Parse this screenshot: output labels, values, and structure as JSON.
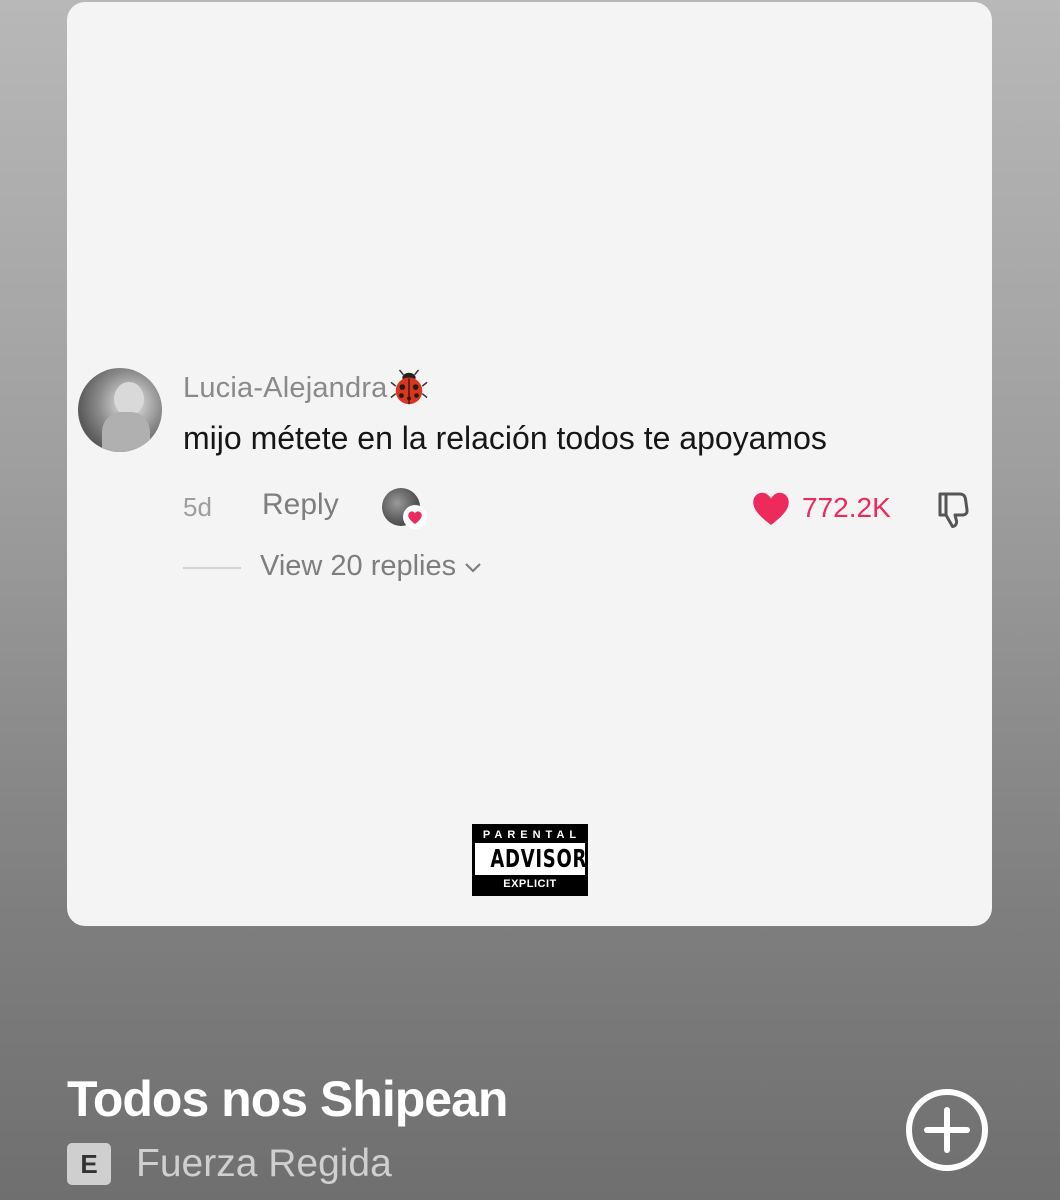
{
  "album_cover": {
    "comment": {
      "username": "Lucia-Alejandra",
      "username_emoji_icon": "ladybug-icon",
      "text": "mijo métete en la relación todos te apoyamos",
      "time": "5d",
      "reply_label": "Reply",
      "like_count": "772.2K",
      "view_replies_label": "View 20 replies"
    },
    "advisory_label": {
      "top": "PARENTAL",
      "middle": "ADVISORY",
      "bottom": "EXPLICIT CONTENT"
    }
  },
  "track": {
    "title": "Todos nos Shipean",
    "explicit_badge": "E",
    "artist": "Fuerza Regida",
    "add_icon": "plus-circle-icon"
  },
  "colors": {
    "like": "#ee2a5c",
    "cover_background": "#f4f4f4",
    "title": "#ffffff",
    "artist": "#cfcfcf"
  }
}
